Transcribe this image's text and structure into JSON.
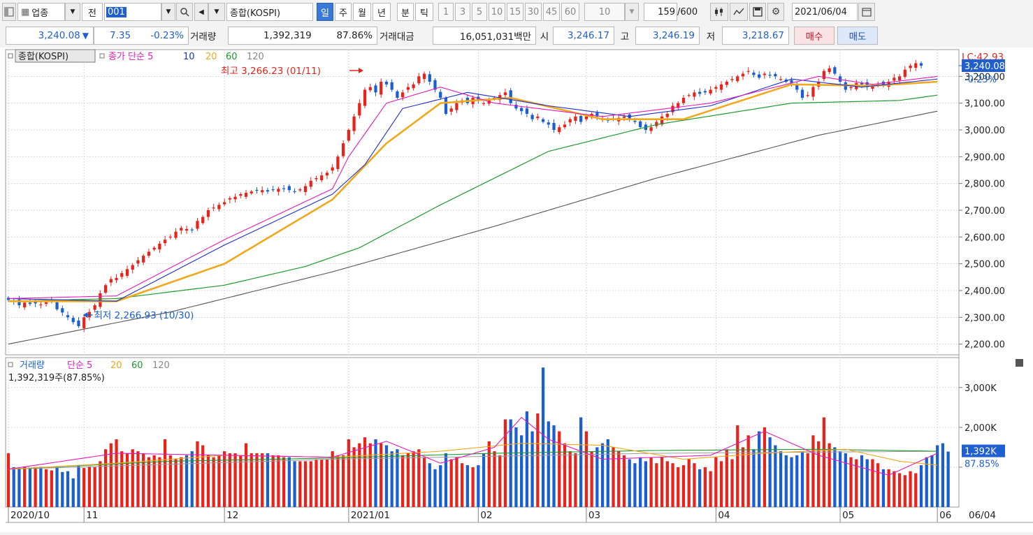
{
  "toolbar": {
    "sector_label": "업종",
    "prev_label": "전",
    "code": "001",
    "index_name": "종합(KOSPI)",
    "periods": [
      "일",
      "주",
      "월",
      "년",
      "분",
      "틱"
    ],
    "selected_period": "일",
    "minute_intervals": [
      "1",
      "3",
      "5",
      "10",
      "15",
      "30",
      "45",
      "60"
    ],
    "count_value": "10",
    "data_count": "159",
    "data_max": "/600",
    "date": "2021/06/04"
  },
  "quote": {
    "price": "3,240.08",
    "direction": "▼",
    "change": "7.35",
    "change_pct": "-0.23%",
    "volume_label": "거래량",
    "volume": "1,392,319",
    "volume_ratio": "87.86%",
    "amount_label": "거래대금",
    "amount": "16,051,031백만",
    "open_label": "시",
    "open": "3,246.17",
    "high_label": "고",
    "high": "3,246.19",
    "low_label": "저",
    "low": "3,218.67",
    "buy_label": "매수",
    "sell_label": "매도"
  },
  "price_legend": {
    "name": "종합(KOSPI)",
    "ma_label": "종가 단순",
    "periods": [
      "5",
      "10",
      "20",
      "60",
      "120"
    ]
  },
  "volume_legend": {
    "name": "거래량",
    "ma_label": "단순",
    "periods": [
      "5",
      "20",
      "60",
      "120"
    ],
    "value_text": "1,392,319주(87.85%)"
  },
  "annotations": {
    "high": "최고 3,266.23 (01/11)",
    "low": "최저 2,266.93 (10/30)"
  },
  "right_labels": {
    "lc": "LC:42.93",
    "price": "3,240.08",
    "pct": "-0.23%",
    "volume": "1,392K",
    "volume_pct": "87.85%"
  },
  "colors": {
    "up": "#e8231c",
    "down": "#1a5fd1",
    "ma5": "#e41cb9",
    "ma10": "#1f2fc8",
    "ma20": "#f0a81c",
    "ma60": "#1e9a2e",
    "ma120": "#555555",
    "current_label_bg": "#1f5fd0"
  },
  "chart_data": [
    {
      "type": "candlestick",
      "title": "종합(KOSPI)",
      "y_ticks": [
        2200,
        2300,
        2400,
        2500,
        2600,
        2700,
        2800,
        2900,
        3000,
        3100,
        3200
      ],
      "y_tick_labels": [
        "2,200.00",
        "2,300.00",
        "2,400.00",
        "2,500.00",
        "2,600.00",
        "2,700.00",
        "2,800.00",
        "2,900.00",
        "3,000.00",
        "3,100.00",
        "3,200.00"
      ],
      "ylim": [
        2160,
        3300
      ],
      "x_labels": [
        "2020/10",
        "11",
        "12",
        "2021/01",
        "02",
        "03",
        "04",
        "05",
        "06"
      ],
      "x_label_index": [
        0,
        14,
        40,
        63,
        87,
        107,
        131,
        154,
        172
      ],
      "last_label": "06/04",
      "closes": [
        2365,
        2360,
        2345,
        2355,
        2350,
        2352,
        2348,
        2356,
        2360,
        2330,
        2318,
        2300,
        2282,
        2267,
        2300,
        2320,
        2345,
        2390,
        2420,
        2443,
        2447,
        2465,
        2480,
        2495,
        2513,
        2530,
        2545,
        2560,
        2575,
        2590,
        2601,
        2620,
        2634,
        2630,
        2625,
        2660,
        2675,
        2700,
        2710,
        2720,
        2730,
        2745,
        2750,
        2760,
        2765,
        2770,
        2775,
        2775,
        2770,
        2775,
        2780,
        2780,
        2775,
        2770,
        2778,
        2790,
        2810,
        2820,
        2830,
        2840,
        2860,
        2900,
        2950,
        3000,
        3050,
        3100,
        3150,
        3160,
        3140,
        3180,
        3170,
        3150,
        3120,
        3140,
        3160,
        3170,
        3200,
        3210,
        3180,
        3150,
        3120,
        3060,
        3080,
        3100,
        3110,
        3100,
        3120,
        3110,
        3100,
        3110,
        3120,
        3130,
        3140,
        3100,
        3080,
        3070,
        3060,
        3040,
        3050,
        3030,
        3020,
        3000,
        3010,
        3020,
        3040,
        3050,
        3030,
        3050,
        3060,
        3050,
        3040,
        3035,
        3040,
        3045,
        3050,
        3040,
        3030,
        3010,
        3000,
        3010,
        3030,
        3050,
        3060,
        3090,
        3100,
        3120,
        3130,
        3140,
        3135,
        3140,
        3150,
        3160,
        3170,
        3180,
        3190,
        3200,
        3210,
        3220,
        3205,
        3195,
        3210,
        3205,
        3200,
        3190,
        3180,
        3175,
        3150,
        3120,
        3130,
        3160,
        3180,
        3220,
        3230,
        3210,
        3180,
        3150,
        3160,
        3175,
        3170,
        3160,
        3165,
        3170,
        3165,
        3180,
        3195,
        3200,
        3225,
        3240,
        3249,
        3240
      ],
      "ma_lines": {
        "ma5": [
          [
            0,
            2370
          ],
          [
            20,
            2380
          ],
          [
            40,
            2590
          ],
          [
            60,
            2780
          ],
          [
            63,
            2900
          ],
          [
            70,
            3100
          ],
          [
            80,
            3160
          ],
          [
            90,
            3100
          ],
          [
            110,
            3050
          ],
          [
            130,
            3100
          ],
          [
            150,
            3200
          ],
          [
            160,
            3170
          ],
          [
            172,
            3200
          ]
        ],
        "ma10": [
          [
            0,
            2370
          ],
          [
            20,
            2360
          ],
          [
            40,
            2570
          ],
          [
            60,
            2760
          ],
          [
            66,
            2870
          ],
          [
            73,
            3080
          ],
          [
            85,
            3140
          ],
          [
            100,
            3090
          ],
          [
            115,
            3050
          ],
          [
            130,
            3090
          ],
          [
            145,
            3190
          ],
          [
            158,
            3160
          ],
          [
            172,
            3190
          ]
        ],
        "ma20": [
          [
            0,
            2360
          ],
          [
            20,
            2360
          ],
          [
            40,
            2500
          ],
          [
            60,
            2740
          ],
          [
            70,
            2950
          ],
          [
            80,
            3100
          ],
          [
            93,
            3120
          ],
          [
            110,
            3040
          ],
          [
            125,
            3040
          ],
          [
            145,
            3170
          ],
          [
            160,
            3165
          ],
          [
            172,
            3180
          ]
        ],
        "ma60": [
          [
            0,
            2360
          ],
          [
            20,
            2370
          ],
          [
            40,
            2420
          ],
          [
            55,
            2490
          ],
          [
            65,
            2560
          ],
          [
            80,
            2720
          ],
          [
            100,
            2920
          ],
          [
            120,
            3020
          ],
          [
            145,
            3100
          ],
          [
            165,
            3110
          ],
          [
            172,
            3130
          ]
        ],
        "ma120": [
          [
            0,
            2200
          ],
          [
            30,
            2320
          ],
          [
            60,
            2470
          ],
          [
            90,
            2640
          ],
          [
            120,
            2820
          ],
          [
            150,
            2980
          ],
          [
            172,
            3070
          ]
        ]
      }
    },
    {
      "type": "bar",
      "title": "거래량",
      "unit": "K",
      "y_ticks": [
        1000,
        2000,
        3000
      ],
      "y_tick_labels": [
        "",
        "2,000K",
        "3,000K"
      ],
      "ylim": [
        0,
        3750
      ],
      "volumes": [
        1350,
        1000,
        980,
        1020,
        990,
        1000,
        1010,
        950,
        920,
        1000,
        880,
        900,
        720,
        1050,
        980,
        1020,
        1000,
        1150,
        1450,
        1600,
        1700,
        1400,
        1350,
        1450,
        1400,
        1350,
        1250,
        1300,
        1250,
        1700,
        1300,
        1200,
        1250,
        1300,
        1400,
        1650,
        1550,
        1300,
        1250,
        1300,
        1400,
        1350,
        1350,
        1300,
        1600,
        1350,
        1350,
        1350,
        1350,
        1300,
        1300,
        1250,
        1250,
        1150,
        1150,
        1150,
        1150,
        1200,
        1200,
        1200,
        1400,
        1300,
        1300,
        1700,
        1500,
        1600,
        1750,
        1600,
        1700,
        1600,
        1550,
        1400,
        1450,
        1300,
        1350,
        1400,
        1450,
        1250,
        1100,
        950,
        1050,
        1350,
        1200,
        1250,
        1100,
        1050,
        1000,
        1050,
        1350,
        1650,
        1400,
        1300,
        2200,
        2200,
        2000,
        1800,
        2400,
        1900,
        2350,
        3500,
        2150,
        2050,
        1900,
        1600,
        1400,
        1350,
        2250,
        1900,
        1400,
        1500,
        1600,
        1700,
        1500,
        1400,
        1300,
        1200,
        1100,
        1250,
        1150,
        1250,
        1100,
        1250,
        1150,
        1100,
        1000,
        1050,
        1200,
        1100,
        950,
        1000,
        900,
        1250,
        1150,
        1450,
        1200,
        2050,
        1500,
        1800,
        1450,
        1900,
        2000,
        1750,
        1550,
        1400,
        1300,
        1250,
        1300,
        1400,
        1350,
        1800,
        1650,
        2250,
        1600,
        1500,
        1400,
        1350,
        1250,
        1200,
        1300,
        1200,
        1200,
        1100,
        950,
        950,
        900,
        850,
        800,
        900,
        850,
        1050,
        1250,
        1300,
        1550,
        1600,
        1392
      ],
      "ma5_points": [
        [
          0,
          950
        ],
        [
          20,
          1350
        ],
        [
          40,
          1300
        ],
        [
          60,
          1250
        ],
        [
          70,
          1650
        ],
        [
          80,
          1100
        ],
        [
          90,
          1500
        ],
        [
          95,
          2250
        ],
        [
          100,
          1700
        ],
        [
          110,
          1200
        ],
        [
          130,
          1300
        ],
        [
          140,
          1900
        ],
        [
          150,
          1300
        ],
        [
          163,
          800
        ],
        [
          172,
          1350
        ]
      ],
      "ma20_points": [
        [
          0,
          950
        ],
        [
          20,
          1100
        ],
        [
          40,
          1300
        ],
        [
          60,
          1250
        ],
        [
          80,
          1400
        ],
        [
          95,
          1600
        ],
        [
          110,
          1550
        ],
        [
          125,
          1200
        ],
        [
          140,
          1350
        ],
        [
          155,
          1450
        ],
        [
          165,
          1150
        ],
        [
          172,
          1050
        ]
      ],
      "ma60_points": [
        [
          0,
          950
        ],
        [
          30,
          1150
        ],
        [
          60,
          1230
        ],
        [
          90,
          1350
        ],
        [
          120,
          1420
        ],
        [
          150,
          1450
        ],
        [
          172,
          1400
        ]
      ],
      "ma120_points": [
        [
          0,
          950
        ],
        [
          60,
          1200
        ],
        [
          120,
          1350
        ],
        [
          172,
          1400
        ]
      ]
    }
  ]
}
